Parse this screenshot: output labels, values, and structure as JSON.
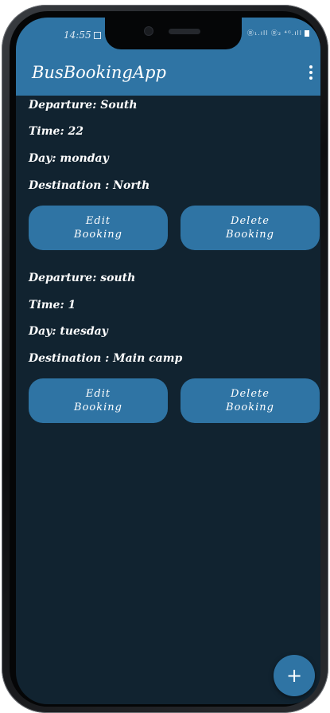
{
  "status_bar": {
    "time": "14:55",
    "network": "Ⓡ₁.ıll Ⓡ₂ ⁴ᴳ.ıll"
  },
  "app_bar": {
    "title": "BusBookingApp"
  },
  "bookings": [
    {
      "departure": "Departure: South",
      "time": "Time: 22",
      "day": "Day: monday",
      "destination": "Destination : North",
      "edit_label_1": "Edit",
      "edit_label_2": "Booking",
      "delete_label_1": "Delete",
      "delete_label_2": "Booking"
    },
    {
      "departure": "Departure: south",
      "time": "Time: 1",
      "day": "Day: tuesday",
      "destination": "Destination : Main camp",
      "edit_label_1": "Edit",
      "edit_label_2": "Booking",
      "delete_label_1": "Delete",
      "delete_label_2": "Booking"
    }
  ],
  "fab": {
    "label": "+"
  },
  "colors": {
    "app_bar": "#2f74a4",
    "background": "#112330",
    "button": "#2f74a4",
    "text": "#ffffff"
  },
  "icons": {
    "overflow": "more-vert-icon",
    "add": "plus-icon"
  }
}
